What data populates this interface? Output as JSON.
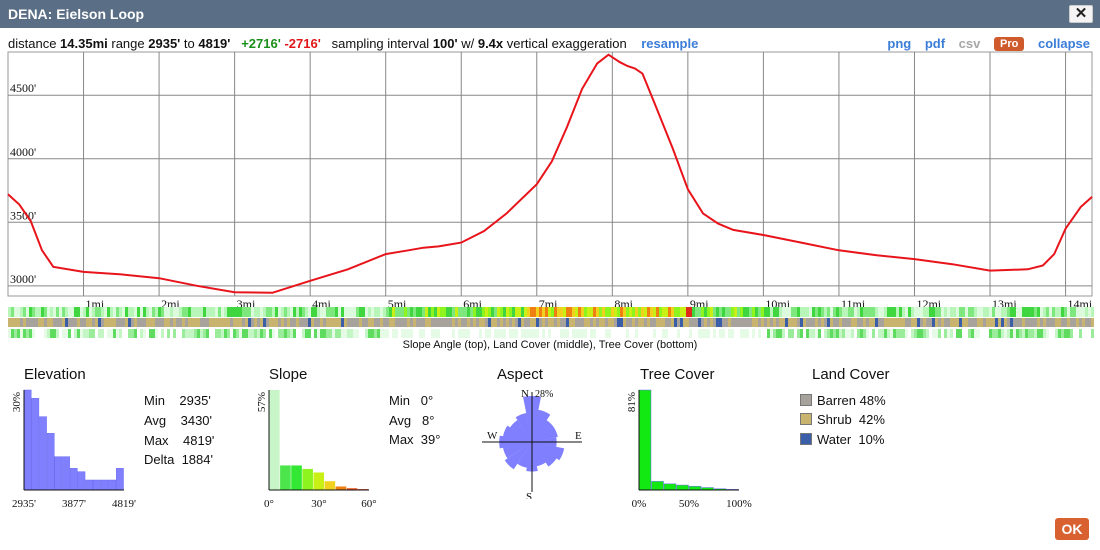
{
  "window": {
    "title": "DENA: Eielson Loop",
    "close_label": "✕"
  },
  "summary": {
    "distance_label": "distance",
    "distance": "14.35mi",
    "range_label": "range",
    "range_min": "2935'",
    "to_label": "to",
    "range_max": "4819'",
    "gain": "+2716'",
    "loss": "-2716'",
    "interval_label": "sampling interval",
    "interval": "100'",
    "w_label": "w/",
    "exaggeration": "9.4x",
    "exag_label": "vertical exaggeration",
    "resample_label": "resample"
  },
  "toolbar": {
    "png": "png",
    "pdf": "pdf",
    "csv": "csv",
    "pro": "Pro",
    "collapse": "collapse"
  },
  "chart_data": [
    {
      "type": "line",
      "title": "",
      "xlabel": "",
      "ylabel": "",
      "x_ticks": [
        "1mi",
        "2mi",
        "3mi",
        "4mi",
        "5mi",
        "6mi",
        "7mi",
        "8mi",
        "9mi",
        "10mi",
        "11mi",
        "12mi",
        "13mi",
        "14mi"
      ],
      "y_ticks": [
        "3000'",
        "3500'",
        "4000'",
        "4500'"
      ],
      "xlim": [
        0,
        14.35
      ],
      "ylim": [
        2920,
        4840
      ],
      "color": "#e8141b",
      "x": [
        0,
        0.15,
        0.3,
        0.45,
        0.6,
        1,
        1.5,
        2,
        2.5,
        3,
        3.5,
        4,
        4.5,
        5,
        5.3,
        5.5,
        5.7,
        6,
        6.3,
        6.6,
        7,
        7.2,
        7.4,
        7.6,
        7.8,
        7.95,
        8.1,
        8.2,
        8.3,
        8.4,
        8.55,
        8.8,
        9,
        9.2,
        9.4,
        9.6,
        10,
        10.5,
        11,
        11.5,
        12,
        12.5,
        13,
        13.5,
        13.7,
        13.85,
        14,
        14.2,
        14.35
      ],
      "y": [
        3720,
        3640,
        3510,
        3280,
        3150,
        3110,
        3090,
        3060,
        3000,
        2950,
        2945,
        3040,
        3130,
        3250,
        3280,
        3300,
        3310,
        3340,
        3430,
        3570,
        3800,
        3980,
        4250,
        4550,
        4750,
        4819,
        4760,
        4730,
        4710,
        4670,
        4450,
        4080,
        3760,
        3570,
        3490,
        3440,
        3400,
        3340,
        3280,
        3240,
        3210,
        3170,
        3120,
        3130,
        3160,
        3250,
        3450,
        3620,
        3700
      ]
    },
    {
      "type": "bar",
      "title": "Elevation",
      "x_ticks": [
        "2935'",
        "3877'",
        "4819'"
      ],
      "y_max_label": "30%",
      "ylim": [
        0,
        30
      ],
      "values": [
        30,
        27.5,
        22,
        17,
        10,
        10,
        6.5,
        5.5,
        3,
        3,
        3,
        3,
        6.5
      ],
      "color": "#8080ff"
    },
    {
      "type": "bar",
      "title": "Slope",
      "x_ticks": [
        "0°",
        "30°",
        "60°"
      ],
      "y_max_label": "57%",
      "ylim": [
        0,
        57
      ],
      "values": [
        57,
        14,
        14,
        12,
        10,
        5,
        2,
        1,
        0.5
      ],
      "colors": [
        "#c8f5c8",
        "#4ce64c",
        "#33e833",
        "#8ef41e",
        "#c8f014",
        "#f0d21e",
        "#ee7f10",
        "#e8501a",
        "#e8301a"
      ]
    },
    {
      "type": "polar",
      "title": "Aspect",
      "directions": [
        "N",
        "E",
        "S",
        "W"
      ],
      "max_label": "28%",
      "values": [
        28,
        20,
        16,
        16,
        15,
        20,
        18,
        15,
        18,
        16,
        20,
        18,
        20,
        18,
        16,
        18
      ],
      "color": "#8080ff"
    },
    {
      "type": "bar",
      "title": "Tree Cover",
      "x_ticks": [
        "0%",
        "50%",
        "100%"
      ],
      "y_max_label": "81%",
      "ylim": [
        0,
        81
      ],
      "values": [
        81,
        7,
        5,
        4,
        3,
        2,
        1,
        0.5
      ],
      "color": "#12e812"
    }
  ],
  "strips": {
    "caption": "Slope Angle (top), Land Cover (middle), Tree Cover (bottom)"
  },
  "stats": {
    "elevation": {
      "title": "Elevation",
      "rows": [
        "Min    2935'",
        "Avg    3430'",
        "Max    4819'",
        "Delta  1884'"
      ]
    },
    "slope": {
      "title": "Slope",
      "rows": [
        "Min   0°",
        "Avg   8°",
        "Max  39°"
      ]
    },
    "aspect": {
      "title": "Aspect"
    },
    "tree": {
      "title": "Tree Cover"
    },
    "land": {
      "title": "Land Cover",
      "items": [
        {
          "label": "Barren 48%",
          "color": "#a8a29c"
        },
        {
          "label": "Shrub  42%",
          "color": "#c8b46e"
        },
        {
          "label": "Water  10%",
          "color": "#3a5fa8"
        }
      ]
    }
  },
  "footer": {
    "ok_label": "OK"
  }
}
